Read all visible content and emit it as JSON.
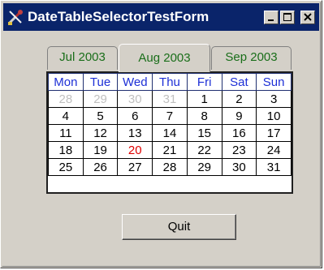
{
  "window": {
    "title": "DateTableSelectorTestForm",
    "app_icon": "tools-icon",
    "caption_buttons": [
      "minimize-icon",
      "maximize-icon",
      "close-icon"
    ]
  },
  "tabs": [
    {
      "label": "Jul 2003",
      "active": false
    },
    {
      "label": "Aug 2003",
      "active": true
    },
    {
      "label": "Sep 2003",
      "active": false
    }
  ],
  "calendar": {
    "weekdays": [
      "Mon",
      "Tue",
      "Wed",
      "Thu",
      "Fri",
      "Sat",
      "Sun"
    ],
    "weeks": [
      [
        "28",
        "29",
        "30",
        "31",
        "1",
        "2",
        "3"
      ],
      [
        "4",
        "5",
        "6",
        "7",
        "8",
        "9",
        "10"
      ],
      [
        "11",
        "12",
        "13",
        "14",
        "15",
        "16",
        "17"
      ],
      [
        "18",
        "19",
        "20",
        "21",
        "22",
        "23",
        "24"
      ],
      [
        "25",
        "26",
        "27",
        "28",
        "29",
        "30",
        "31"
      ]
    ],
    "today": "20",
    "colors": {
      "header_text": "#1d2fd6",
      "other_month": "#c0c0c0",
      "today": "#e00000",
      "tab_text": "#1a6e1a"
    }
  },
  "quit_button": {
    "label": "Quit"
  }
}
